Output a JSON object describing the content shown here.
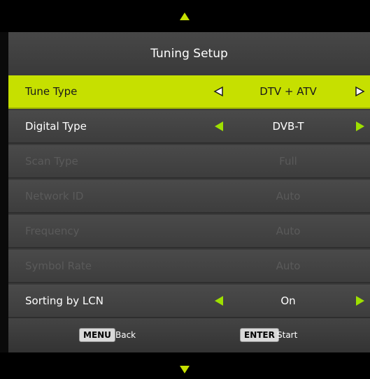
{
  "title": "Tuning Setup",
  "rows": [
    {
      "label": "Tune Type",
      "value": "DTV + ATV"
    },
    {
      "label": "Digital Type",
      "value": "DVB-T"
    },
    {
      "label": "Scan Type",
      "value": "Full"
    },
    {
      "label": "Network ID",
      "value": "Auto"
    },
    {
      "label": "Frequency",
      "value": "Auto"
    },
    {
      "label": "Symbol Rate",
      "value": "Auto"
    },
    {
      "label": "Sorting by LCN",
      "value": "On"
    }
  ],
  "footer": {
    "menu_key": "MENU",
    "menu_label": "Back",
    "enter_key": "ENTER",
    "enter_label": "Start"
  },
  "colors": {
    "accent": "#c6e000",
    "arrow": "#9ee000",
    "panel": "#3c3c3c",
    "disabled_text": "#5a5a5a"
  },
  "icons": {
    "scroll_up": "triangle-up-icon",
    "scroll_down": "triangle-down-icon",
    "option_prev": "triangle-left-icon",
    "option_next": "triangle-right-icon"
  }
}
